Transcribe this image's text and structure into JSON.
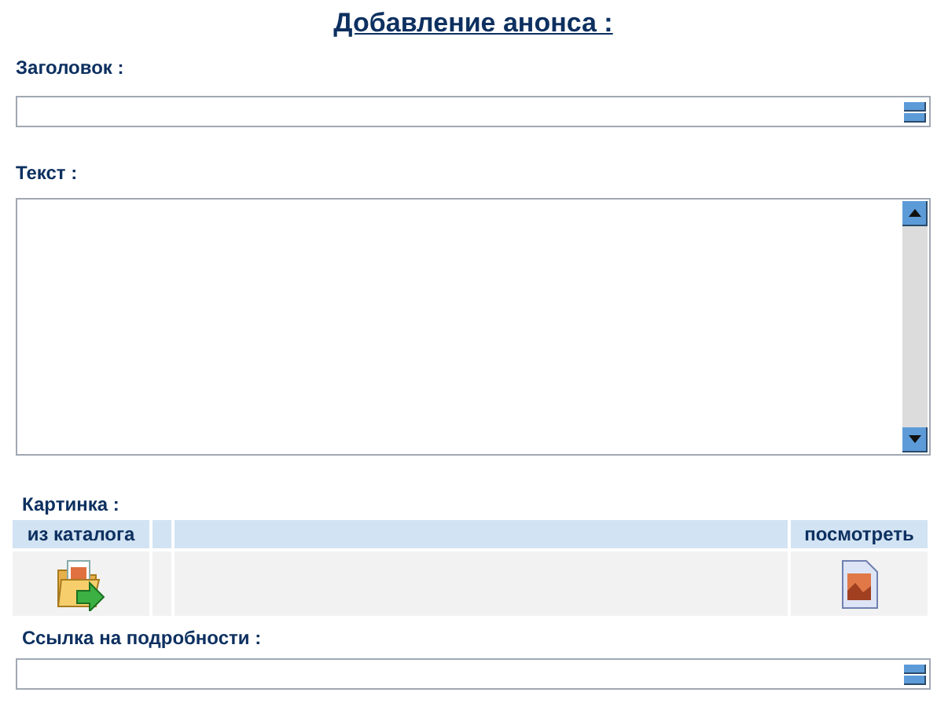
{
  "title": "Добавление анонса :",
  "fields": [
    {
      "kind": "line",
      "label": "Заголовок :"
    },
    {
      "kind": "area",
      "label": "Текст :"
    }
  ],
  "picture": {
    "label": "Картинка :",
    "columns": [
      "из каталога",
      "",
      "",
      "посмотреть"
    ]
  },
  "link_field": {
    "kind": "line",
    "label": "Ссылка на подробности :"
  }
}
